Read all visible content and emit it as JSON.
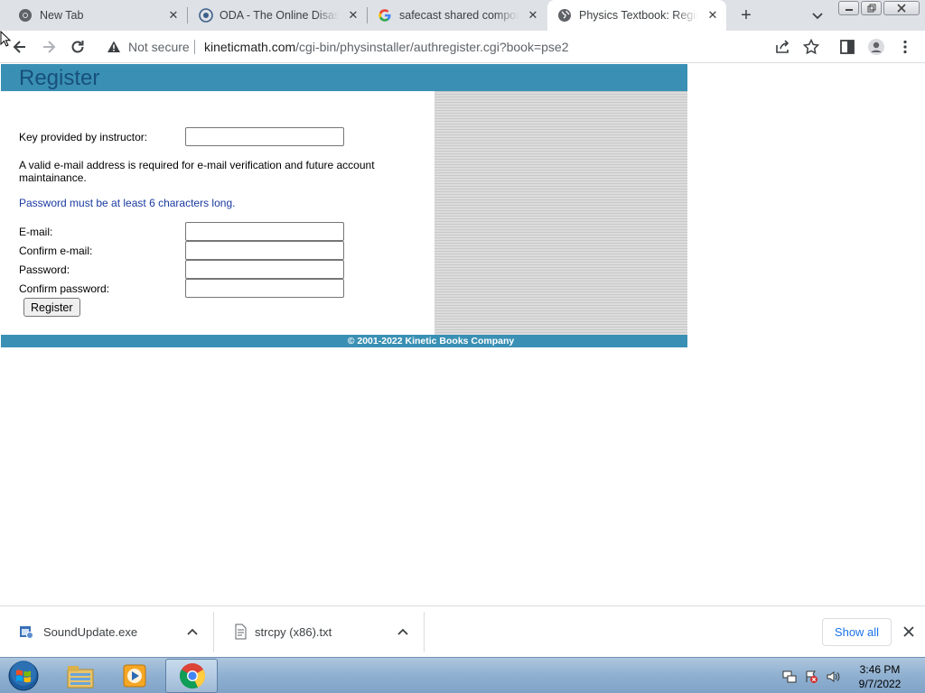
{
  "browser": {
    "tabs": [
      {
        "title": "New Tab",
        "active": false
      },
      {
        "title": "ODA - The Online Disassembler",
        "active": false
      },
      {
        "title": "safecast shared components",
        "active": false
      },
      {
        "title": "Physics Textbook: Register",
        "active": true
      }
    ],
    "omnibox": {
      "security_label": "Not secure",
      "url_host": "kineticmath.com",
      "url_path": "/cgi-bin/physinstaller/authregister.cgi?book=pse2"
    }
  },
  "page": {
    "title": "Register",
    "key_label": "Key provided by instructor:",
    "key_value": "",
    "info_text": "A valid e-mail address is required for e-mail verification and future account maintainance.",
    "password_note": "Password must be at least 6 characters long.",
    "fields": [
      {
        "label": "E-mail:",
        "value": ""
      },
      {
        "label": "Confirm e-mail:",
        "value": ""
      },
      {
        "label": "Password:",
        "value": ""
      },
      {
        "label": "Confirm password:",
        "value": ""
      }
    ],
    "register_button": "Register",
    "footer": "© 2001-2022 Kinetic Books Company",
    "colors": {
      "header": "#3a90b4",
      "title": "#17507a",
      "note": "#1a3aa0"
    }
  },
  "downloads": {
    "items": [
      {
        "name": "SoundUpdate.exe",
        "icon": "exe-file-icon"
      },
      {
        "name": "strcpy (x86).txt",
        "icon": "text-file-icon"
      }
    ],
    "show_all": "Show all"
  },
  "taskbar": {
    "apps": [
      "file-explorer-icon",
      "media-player-icon",
      "chrome-icon"
    ],
    "time": "3:46 PM",
    "date": "9/7/2022"
  }
}
